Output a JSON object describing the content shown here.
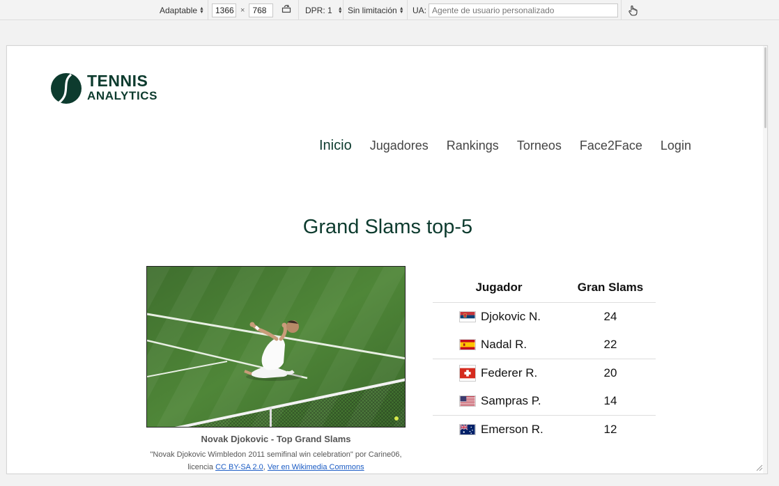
{
  "devtools": {
    "device_mode": "Adaptable",
    "width": "1366",
    "times": "×",
    "height": "768",
    "dpr": "DPR: 1",
    "throttle": "Sin limitación",
    "ua_label": "UA:",
    "ua_placeholder": "Agente de usuario personalizado"
  },
  "brand": {
    "line1": "TENNIS",
    "line2": "ANALYTICS",
    "color": "#0d3b2e"
  },
  "nav": [
    {
      "label": "Inicio",
      "active": true
    },
    {
      "label": "Jugadores"
    },
    {
      "label": "Rankings"
    },
    {
      "label": "Torneos"
    },
    {
      "label": "Face2Face"
    },
    {
      "label": "Login"
    }
  ],
  "section_title": "Grand Slams top-5",
  "photo": {
    "title": "Novak Djokovic - Top Grand Slams",
    "credit": "\"Novak Djokovic Wimbledon 2011 semifinal win celebration\" por Carine06,",
    "license_prefix": "licencia",
    "license_link": "CC BY-SA 2.0",
    "commons_link": "Ver en Wikimedia Commons"
  },
  "table": {
    "headers": [
      "Jugador",
      "Gran Slams"
    ],
    "rows": [
      {
        "player": "Djokovic N.",
        "slams": "24",
        "flag": "serbia-flag-icon"
      },
      {
        "player": "Nadal R.",
        "slams": "22",
        "flag": "spain-flag-icon"
      },
      {
        "player": "Federer R.",
        "slams": "20",
        "flag": "switzerland-flag-icon"
      },
      {
        "player": "Sampras P.",
        "slams": "14",
        "flag": "usa-flag-icon"
      },
      {
        "player": "Emerson R.",
        "slams": "12",
        "flag": "australia-flag-icon"
      }
    ]
  }
}
